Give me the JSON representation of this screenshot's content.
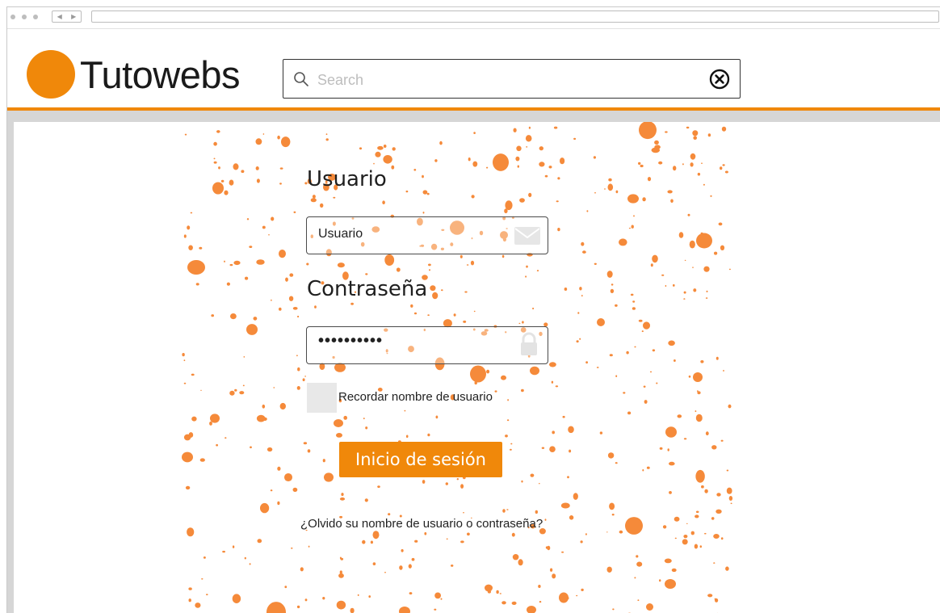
{
  "brand": {
    "name": "Tutowebs",
    "accent_color": "#f0880a"
  },
  "search": {
    "placeholder": "Search",
    "value": ""
  },
  "login": {
    "username_label": "Usuario",
    "username_value": "Usuario",
    "password_label": "Contraseña",
    "password_value": "••••••••••",
    "remember_label": "Recordar nombre de usuario",
    "remember_checked": false,
    "submit_label": "Inicio de sesión",
    "forgot_link": "¿Olvido su nombre de usuario o contraseña?"
  },
  "icons": {
    "search": "search-icon",
    "clear": "close-circle-icon",
    "username_field": "mail-icon",
    "password_field": "lock-icon"
  }
}
